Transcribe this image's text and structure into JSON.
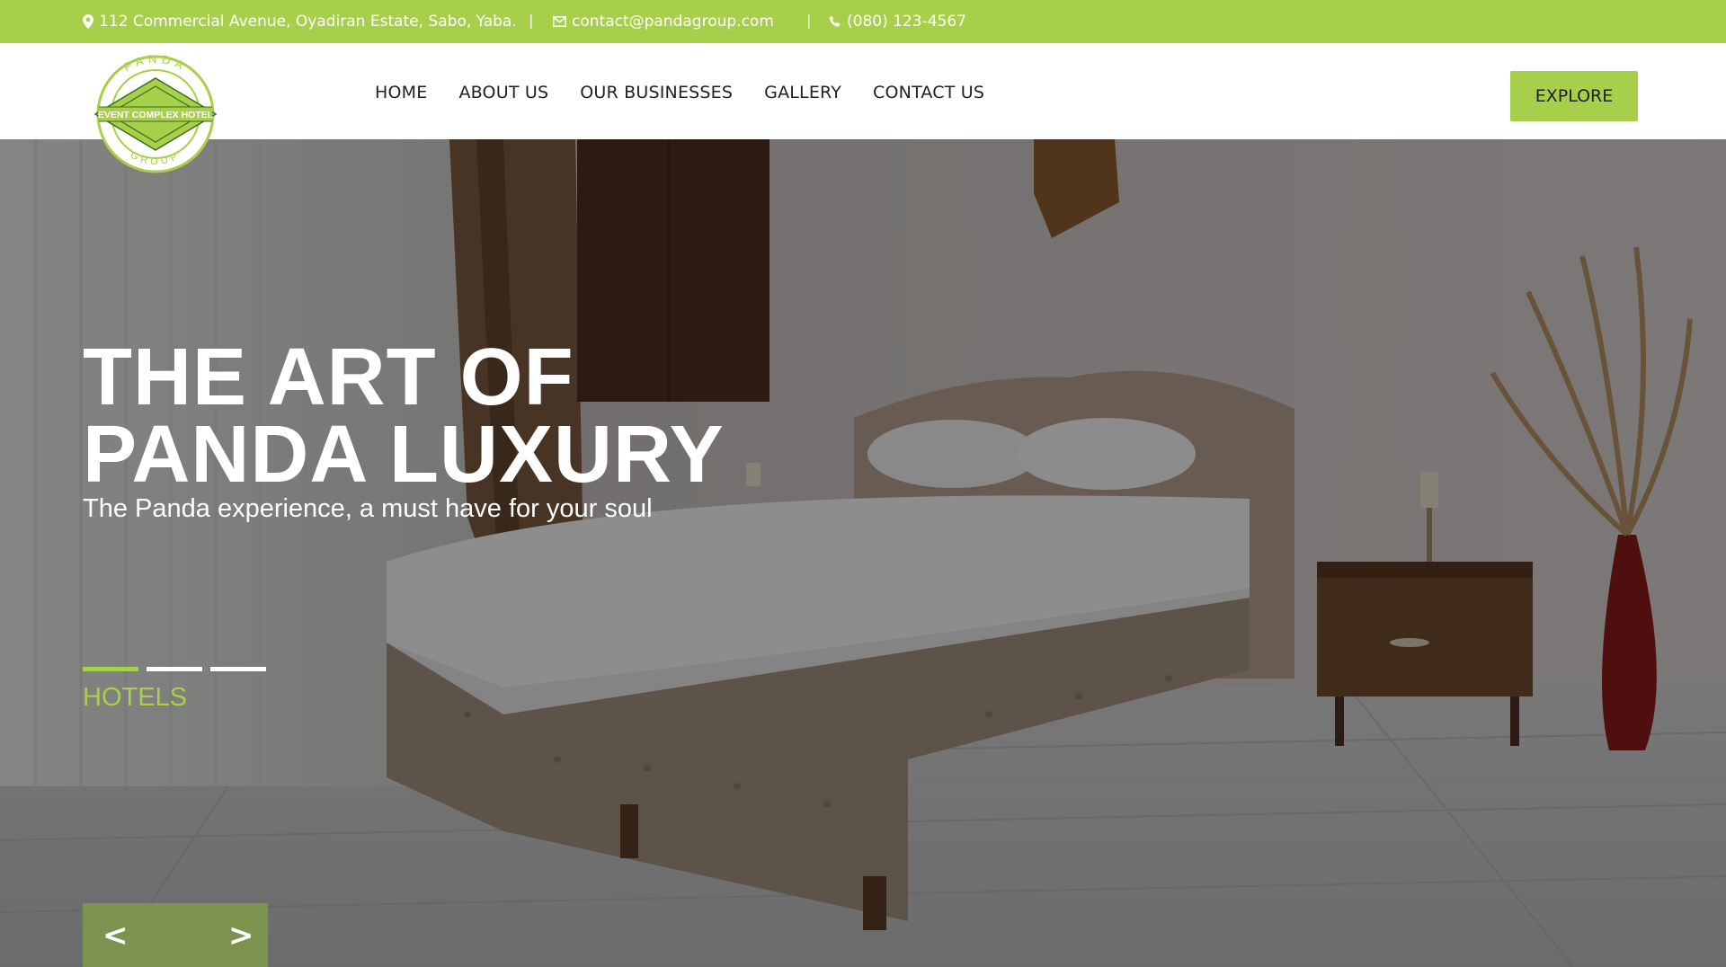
{
  "topbar": {
    "address": "112 Commercial Avenue, Oyadiran Estate, Sabo, Yaba.",
    "separator": "|",
    "email": "contact@pandagroup.com",
    "phone": "(080) 123-4567",
    "icons": [
      "map-pin-icon",
      "mail-icon",
      "phone-icon"
    ]
  },
  "logo": {
    "top_text": "PANDA",
    "band_text": "EVENT COMPLEX HOTEL",
    "bottom_text": "GROUP"
  },
  "nav": {
    "items": [
      "HOME",
      "ABOUT US",
      "OUR BUSINESSES",
      "GALLERY",
      "CONTACT US"
    ]
  },
  "header": {
    "cta_label": "EXPLORE"
  },
  "hero": {
    "title_line1": "THE ART OF",
    "title_line2": "PANDA LUXURY",
    "subtitle": "The Panda experience, a must have for your soul",
    "slide_label": "HOTELS",
    "slide_count": 3,
    "active_slide": 1,
    "prev_label": "<",
    "next_label": ">"
  },
  "colors": {
    "accent": "#a8cf4a",
    "arrow_box": "#7c9350",
    "text_dark": "#222222"
  }
}
